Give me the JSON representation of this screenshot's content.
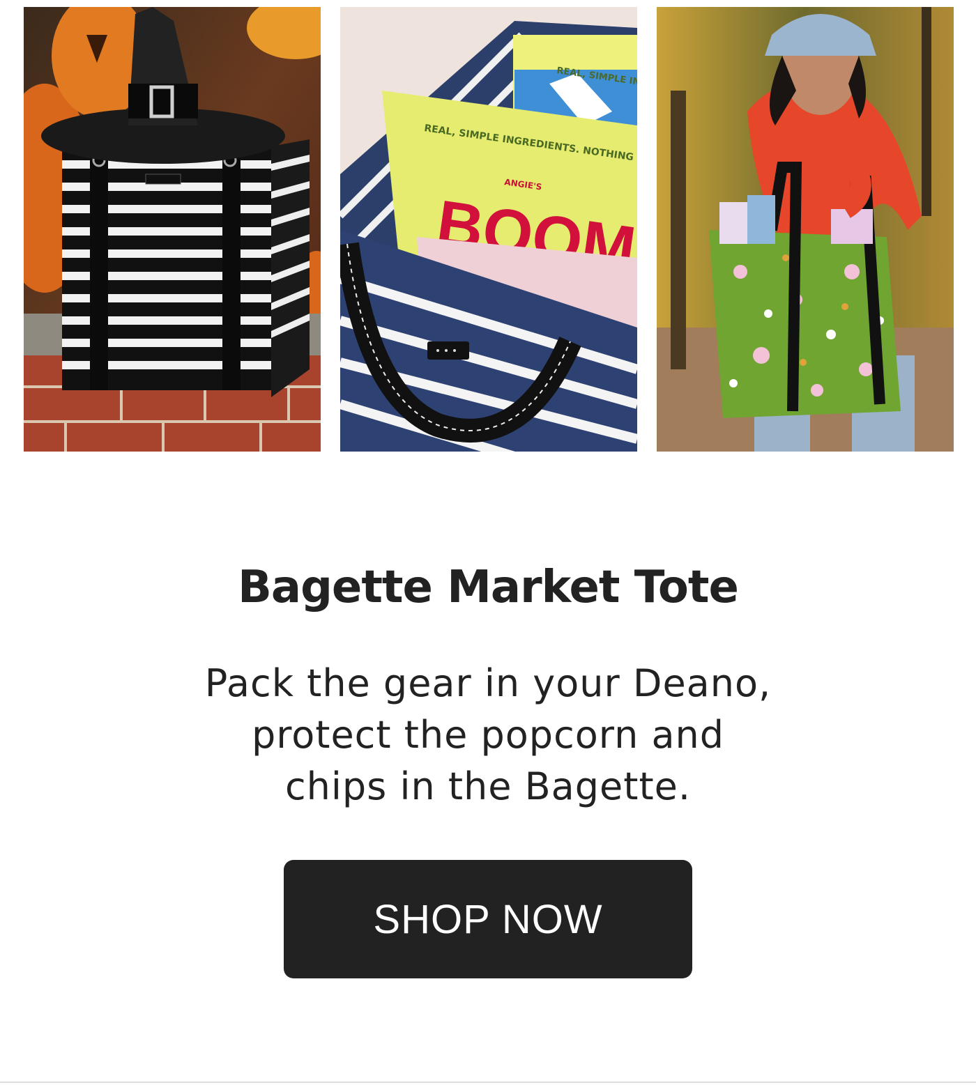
{
  "photos": [
    {
      "alt": "Striped tote with witch hat and pumpkins",
      "palette": {
        "bg": "#b35a2a",
        "accent": "#111111"
      }
    },
    {
      "alt": "Navy striped tote filled with Angie's Boom Chicka Pop bags",
      "label_small": "REAL, SIMPLE INGREDIENTS. NOTHING FAKE.",
      "label_top": "REAL, SIMPLE INGR",
      "brand": "ANGIE'S",
      "big_word": "BOOM"
    },
    {
      "alt": "Woman carrying a green floral tote outdoors",
      "palette": {
        "bg": "#7b7a3a",
        "accent": "#e2462a"
      }
    }
  ],
  "product": {
    "title": "Bagette Market Tote",
    "description_lines": [
      "Pack the gear in your Deano,",
      "protect the popcorn and",
      "chips in the Bagette."
    ]
  },
  "cta": {
    "label": "SHOP NOW"
  }
}
